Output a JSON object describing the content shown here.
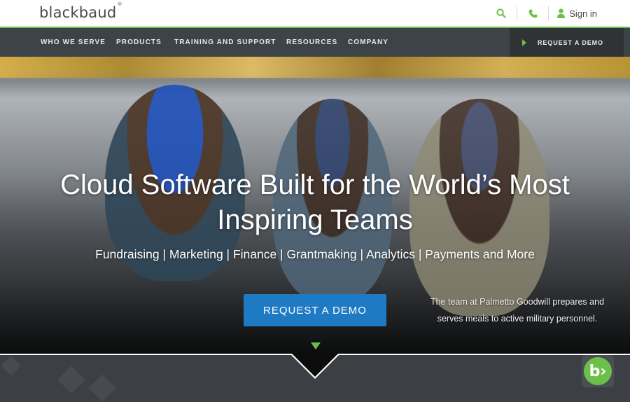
{
  "header": {
    "logo_text": "blackbaud",
    "logo_mark": "®",
    "sign_in": "Sign in",
    "icons": [
      "search-icon",
      "phone-icon",
      "user-icon"
    ],
    "accent": "#6cc04a"
  },
  "nav": {
    "items": [
      {
        "label": "WHO WE SERVE"
      },
      {
        "label": "PRODUCTS"
      },
      {
        "label": "TRAINING AND SUPPORT"
      },
      {
        "label": "RESOURCES"
      },
      {
        "label": "COMPANY"
      }
    ],
    "cta": "REQUEST A DEMO"
  },
  "hero": {
    "title_line1": "Cloud Software Built for the World’s Most",
    "title_line2": "Inspiring Teams",
    "subtitle": "Fundraising | Marketing | Finance | Grantmaking | Analytics | Payments and More",
    "button": "REQUEST A DEMO",
    "caption": "The team at Palmetto Goodwill prepares and serves meals to active military personnel.",
    "button_color": "#1f7ac4"
  },
  "chat": {
    "label": "b›"
  }
}
